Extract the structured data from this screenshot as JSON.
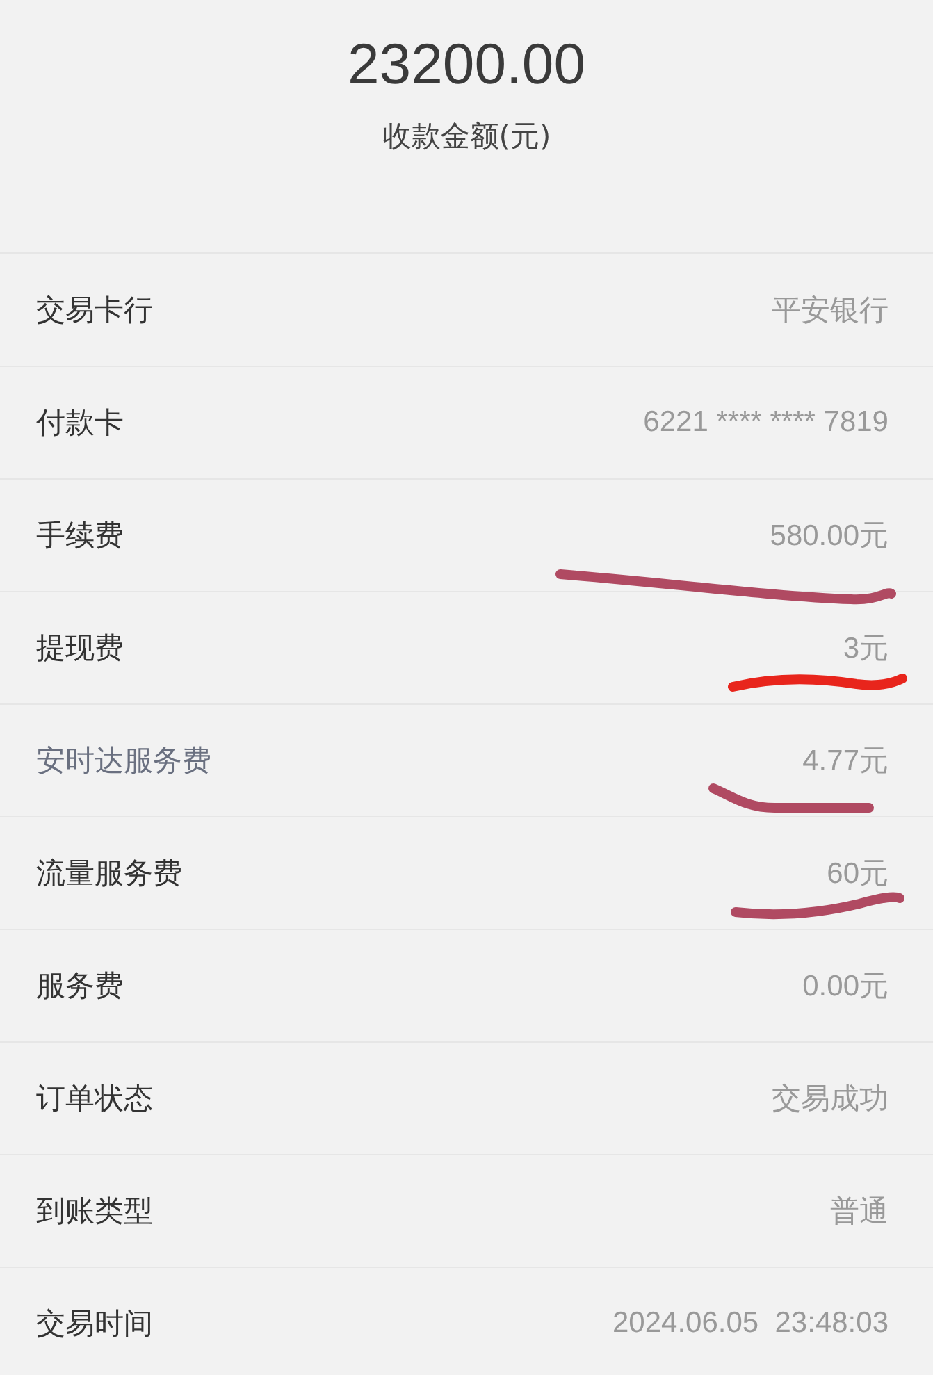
{
  "header": {
    "amount": "23200.00",
    "amount_label": "收款金额(元)"
  },
  "rows": [
    {
      "label": "交易卡行",
      "value": "平安银行",
      "muted": false
    },
    {
      "label": "付款卡",
      "value": "6221 **** **** 7819",
      "muted": false
    },
    {
      "label": "手续费",
      "value": "580.00元",
      "muted": false,
      "underline": {
        "color": "#b04a62"
      }
    },
    {
      "label": "提现费",
      "value": "3元",
      "muted": false,
      "underline": {
        "color": "#e8251c"
      }
    },
    {
      "label": "安时达服务费",
      "value": "4.77元",
      "muted": true,
      "underline": {
        "color": "#b04a62"
      }
    },
    {
      "label": "流量服务费",
      "value": "60元",
      "muted": false,
      "underline": {
        "color": "#b04a62"
      }
    },
    {
      "label": "服务费",
      "value": "0.00元",
      "muted": false
    },
    {
      "label": "订单状态",
      "value": "交易成功",
      "muted": false
    },
    {
      "label": "到账类型",
      "value": "普通",
      "muted": false
    },
    {
      "label": "交易时间",
      "value": "2024.06.05  23:48:03",
      "muted": false
    }
  ]
}
